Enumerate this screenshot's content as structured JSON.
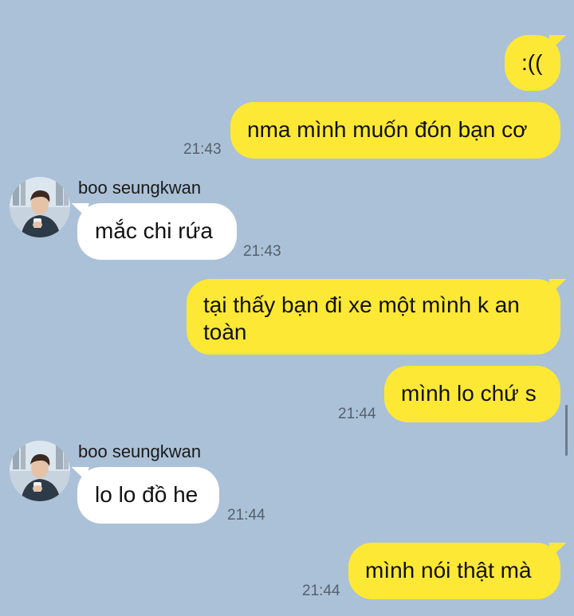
{
  "colors": {
    "background": "#abc1d8",
    "sent_bubble": "#fde835",
    "received_bubble": "#ffffff",
    "timestamp": "#55606d"
  },
  "messages": [
    {
      "direction": "sent",
      "text": ":(("
    },
    {
      "direction": "sent",
      "text": "nma mình muốn đón bạn cơ",
      "time": "21:43"
    },
    {
      "direction": "received",
      "sender": "boo seungkwan",
      "text": "mắc chi rứa",
      "time": "21:43"
    },
    {
      "direction": "sent",
      "text": "tại thấy bạn đi xe một mình k an toàn"
    },
    {
      "direction": "sent",
      "text": "mình lo chứ s",
      "time": "21:44"
    },
    {
      "direction": "received",
      "sender": "boo seungkwan",
      "text": "lo lo đồ he",
      "time": "21:44"
    },
    {
      "direction": "sent",
      "text": "mình nói thật mà",
      "time": "21:44"
    }
  ]
}
